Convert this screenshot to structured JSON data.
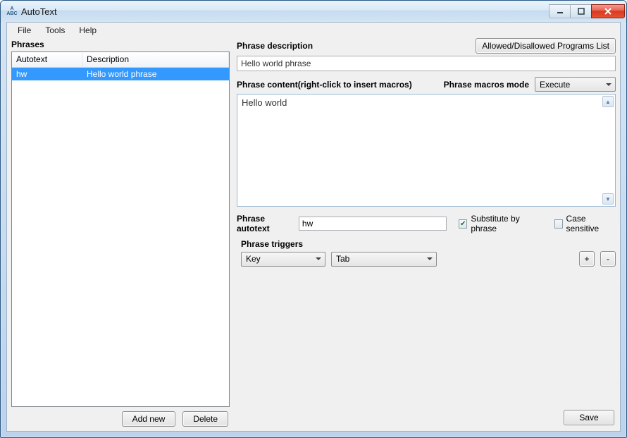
{
  "window": {
    "title": "AutoText"
  },
  "menubar": {
    "file": "File",
    "tools": "Tools",
    "help": "Help"
  },
  "left": {
    "label": "Phrases",
    "columns": {
      "autotext": "Autotext",
      "description": "Description"
    },
    "rows": [
      {
        "autotext": "hw",
        "description": "Hello world phrase"
      }
    ],
    "add_new": "Add new",
    "delete": "Delete"
  },
  "right": {
    "desc_label": "Phrase description",
    "programs_btn": "Allowed/Disallowed Programs List",
    "desc_value": "Hello world phrase",
    "content_label": "Phrase content(right-click to insert macros)",
    "macros_mode_label": "Phrase macros mode",
    "macros_mode_value": "Execute",
    "content_value": "Hello world",
    "autotext_label": "Phrase autotext",
    "autotext_value": "hw",
    "substitute_label": "Substitute by phrase",
    "case_label": "Case sensitive",
    "triggers_label": "Phrase triggers",
    "trigger_type": "Key",
    "trigger_value": "Tab",
    "plus": "+",
    "minus": "-",
    "save": "Save"
  }
}
